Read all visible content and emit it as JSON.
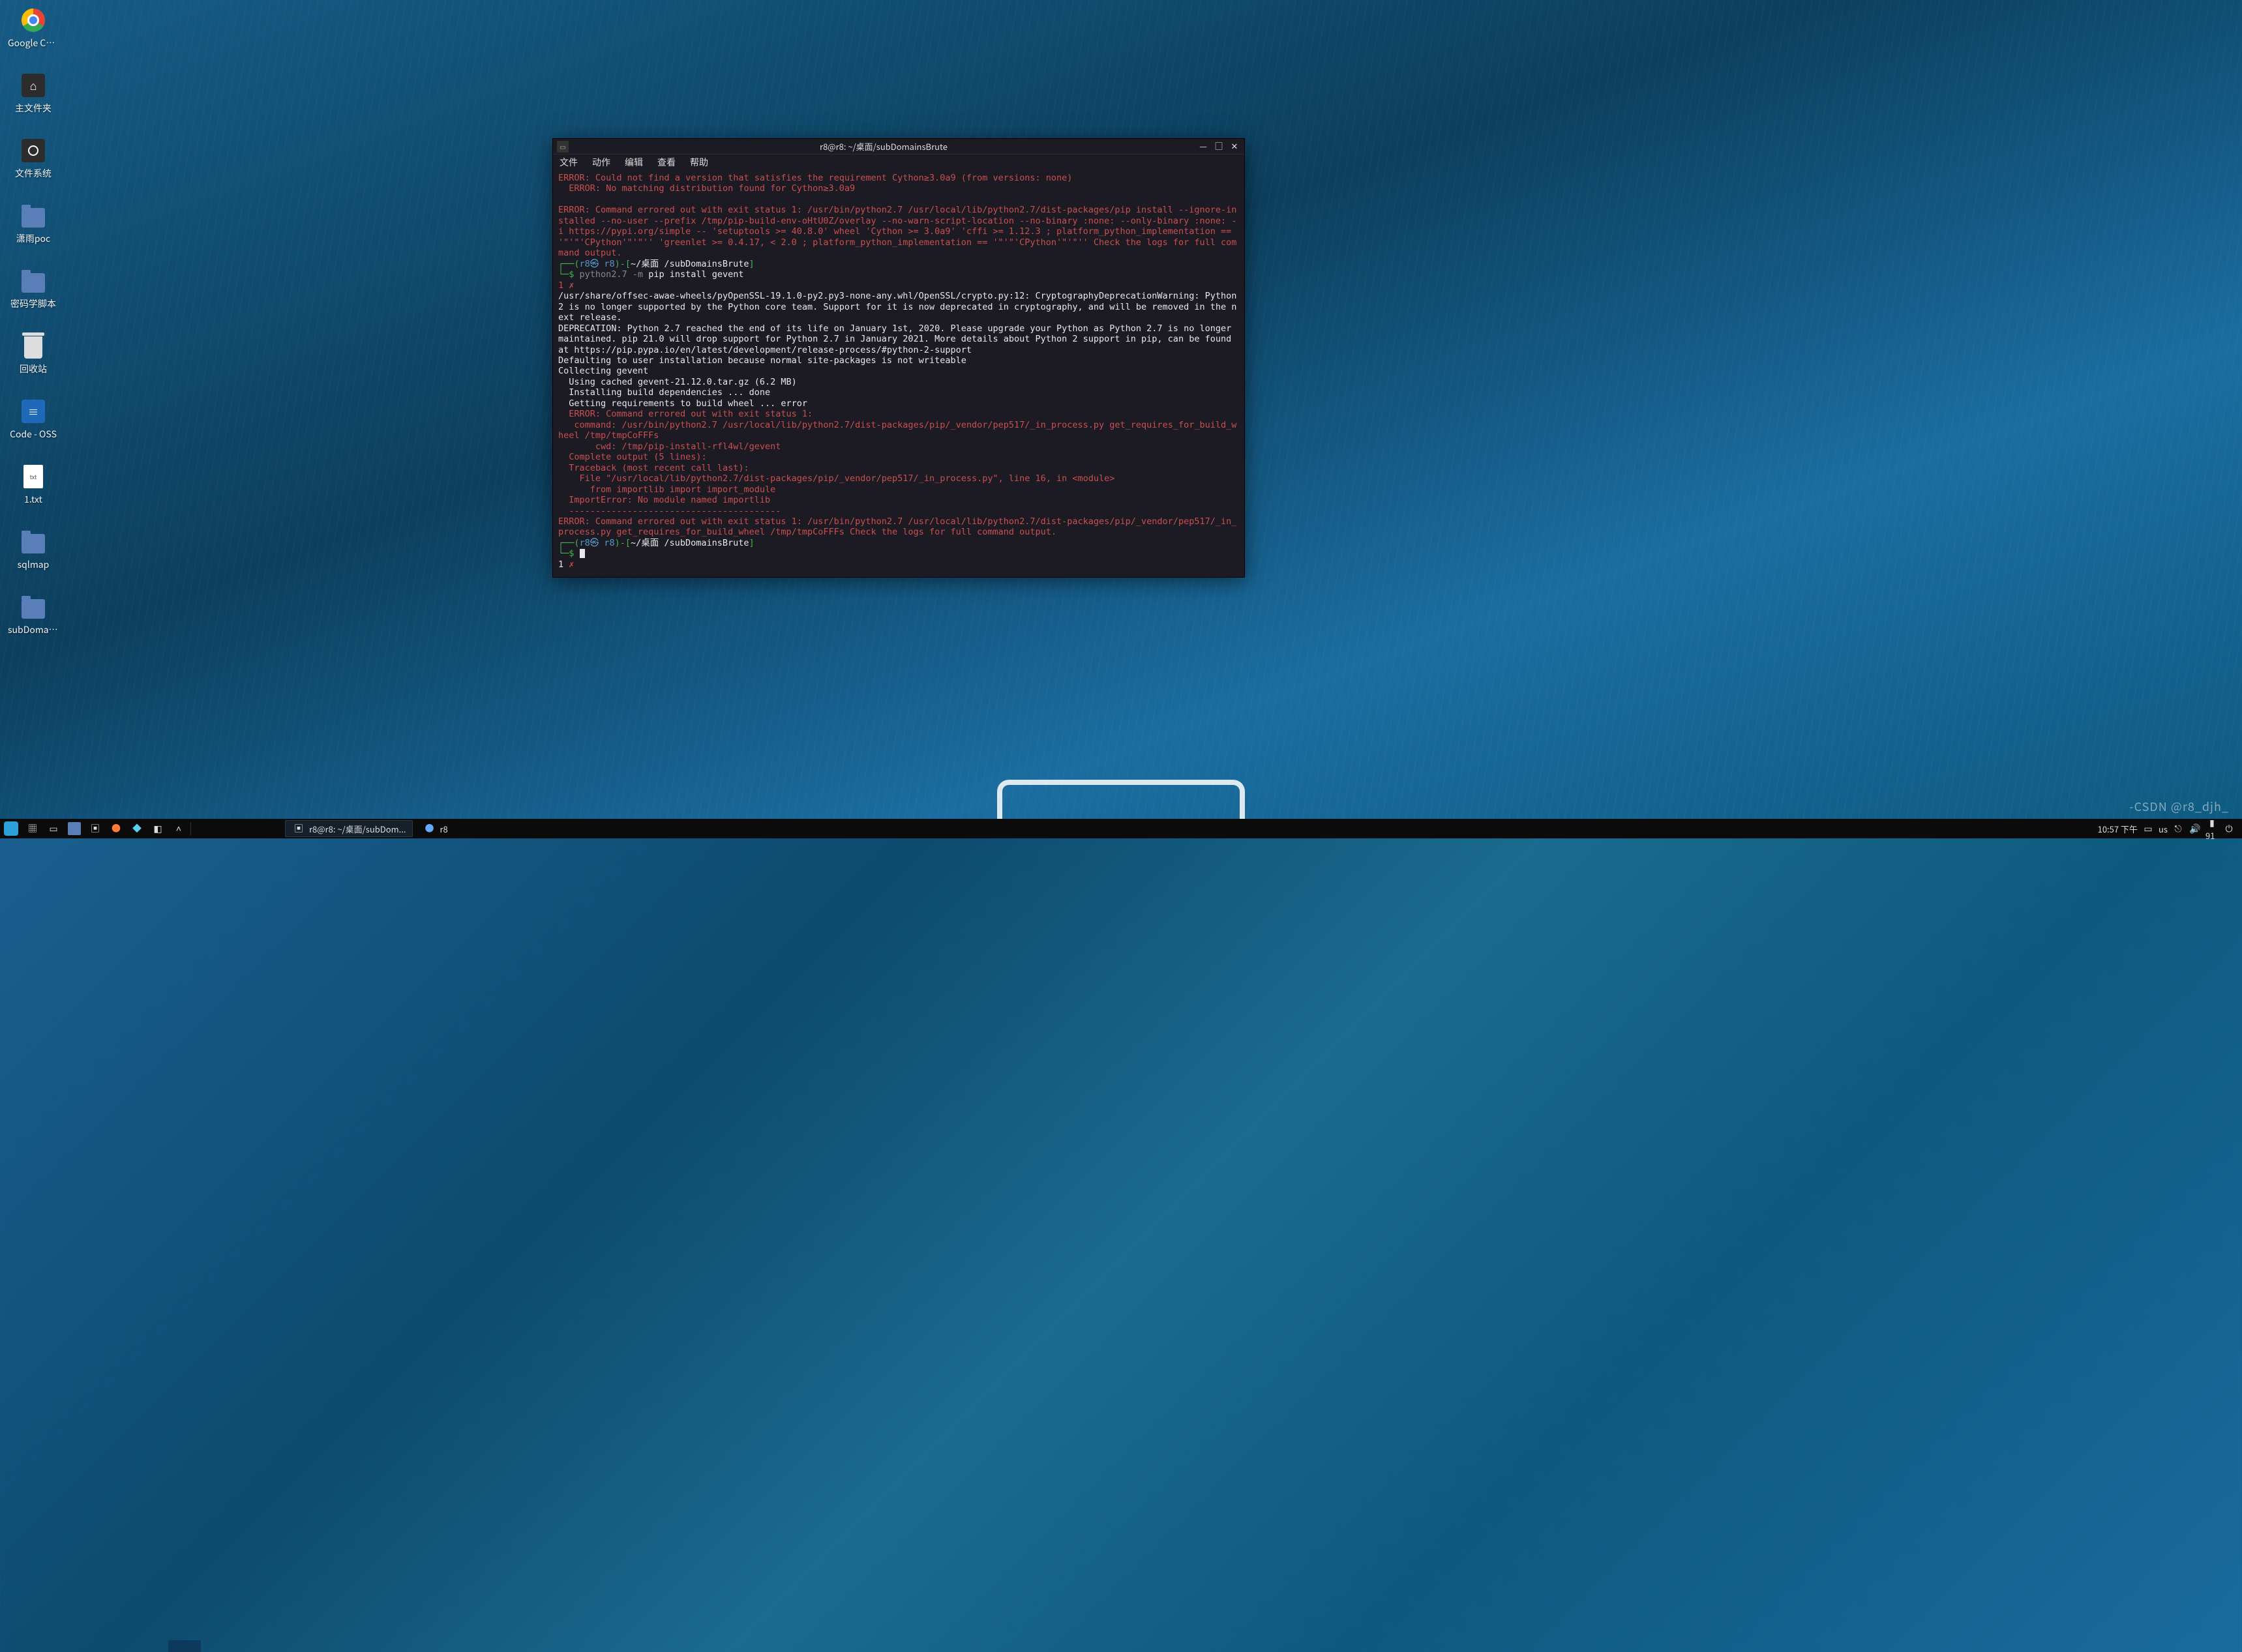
{
  "desktop": {
    "icons": [
      {
        "name": "google-chrome",
        "label": "Google Chr..."
      },
      {
        "name": "home-folder",
        "label": "主文件夹"
      },
      {
        "name": "filesystem",
        "label": "文件系统"
      },
      {
        "name": "folder-xiaoyupoc",
        "label": "潇雨poc"
      },
      {
        "name": "folder-cryptoscript",
        "label": "密码学脚本"
      },
      {
        "name": "trash",
        "label": "回收站"
      },
      {
        "name": "code-oss",
        "label": "Code - OSS"
      },
      {
        "name": "file-1txt",
        "label": "1.txt"
      },
      {
        "name": "folder-sqlmap",
        "label": "sqlmap"
      },
      {
        "name": "folder-subdomain",
        "label": "subDomain..."
      }
    ]
  },
  "terminal": {
    "title": "r8@r8: ~/桌面/subDomainsBrute",
    "menu": [
      "文件",
      "动作",
      "编辑",
      "查看",
      "帮助"
    ],
    "err_block1_l1": "ERROR: Could not find a version that satisfies the requirement Cython≥3.0a9 (from versions: none)",
    "err_block1_l2": "ERROR: No matching distribution found for Cython≥3.0a9",
    "err_block2": "ERROR: Command errored out with exit status 1: /usr/bin/python2.7 /usr/local/lib/python2.7/dist-packages/pip install --ignore-installed --no-user --prefix /tmp/pip-build-env-oHtU0Z/overlay --no-warn-script-location --no-binary :none: --only-binary :none: -i https://pypi.org/simple -- 'setuptools >= 40.8.0' wheel 'Cython >= 3.0a9' 'cffi >= 1.12.3 ; platform_python_implementation == '\"'\"'CPython'\"'\"'' 'greenlet >= 0.4.17, < 2.0 ; platform_python_implementation == '\"'\"'CPython'\"'\"'' Check the logs for full command output.",
    "prompt1_brkt_l": "┌──(",
    "prompt1_user": "r8㉿ r8",
    "prompt1_brkt_m": ")-[",
    "prompt1_path": "~/桌面 /subDomainsBrute",
    "prompt1_brkt_r": "]",
    "prompt1_cmd_l": "└─$ ",
    "prompt1_cmd_py": "python2.7 -m",
    "prompt1_cmd_rest": " pip install gevent",
    "prompt1_status": "1 ✗",
    "out_l1": "/usr/share/offsec-awae-wheels/pyOpenSSL-19.1.0-py2.py3-none-any.whl/OpenSSL/crypto.py:12: CryptographyDeprecationWarning: Python 2 is no longer supported by the Python core team. Support for it is now deprecated in cryptography, and will be removed in the next release.",
    "out_l2": "DEPRECATION: Python 2.7 reached the end of its life on January 1st, 2020. Please upgrade your Python as Python 2.7 is no longer maintained. pip 21.0 will drop support for Python 2.7 in January 2021. More details about Python 2 support in pip, can be found at https://pip.pypa.io/en/latest/development/release-process/#python-2-support",
    "out_l3": "Defaulting to user installation because normal site-packages is not writeable",
    "out_l4": "Collecting gevent",
    "out_l5": "  Using cached gevent-21.12.0.tar.gz (6.2 MB)",
    "out_l6": "  Installing build dependencies ... done",
    "out_l7": "  Getting requirements to build wheel ... error",
    "err3_l1": "  ERROR: Command errored out with exit status 1:",
    "err3_l2": "   command: /usr/bin/python2.7 /usr/local/lib/python2.7/dist-packages/pip/_vendor/pep517/_in_process.py get_requires_for_build_wheel /tmp/tmpCoFFFs",
    "err3_l3": "       cwd: /tmp/pip-install-rfl4wl/gevent",
    "err3_l4": "  Complete output (5 lines):",
    "err3_l5": "  Traceback (most recent call last):",
    "err3_l6": "    File \"/usr/local/lib/python2.7/dist-packages/pip/_vendor/pep517/_in_process.py\", line 16, in <module>",
    "err3_l7": "      from importlib import import_module",
    "err3_l8": "  ImportError: No module named importlib",
    "err3_l9": "  ----------------------------------------",
    "err4": "ERROR: Command errored out with exit status 1: /usr/bin/python2.7 /usr/local/lib/python2.7/dist-packages/pip/_vendor/pep517/_in_process.py get_requires_for_build_wheel /tmp/tmpCoFFFs Check the logs for full command output.",
    "prompt2_path": "~/桌面 /subDomainsBrute",
    "prompt2_status_n": "1",
    "prompt2_status_x": " ✗"
  },
  "panel": {
    "task1": "r8@r8: ~/桌面/subDom...",
    "task2": "r8",
    "clock": "10:57 下午",
    "layout": "us",
    "battery": "91"
  },
  "watermark": "-CSDN @r8_djh_"
}
